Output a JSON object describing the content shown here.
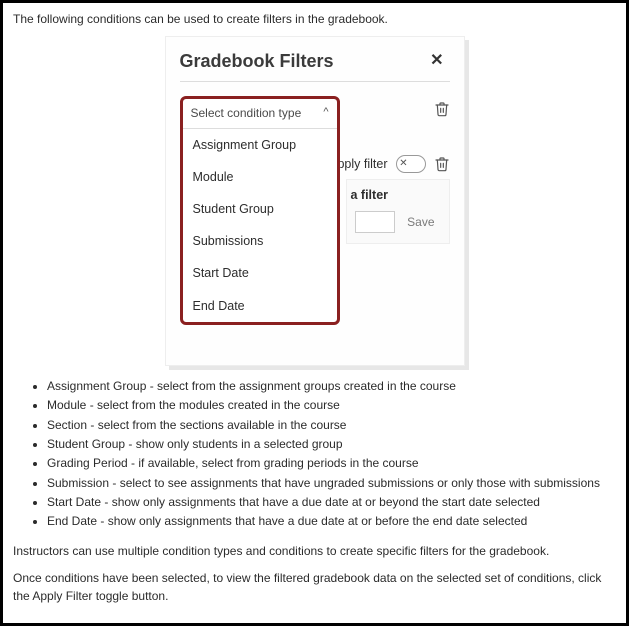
{
  "intro": "The following conditions can be used to create filters in the gradebook.",
  "panel": {
    "title": "Gradebook Filters",
    "dropdown": {
      "placeholder": "Select condition type",
      "options": {
        "o0": "Assignment Group",
        "o1": "Module",
        "o2": "Student Group",
        "o3": "Submissions",
        "o4": "Start Date",
        "o5": "End Date"
      }
    },
    "apply_label": "Apply filter",
    "filter_section_label": "a filter",
    "save_label": "Save"
  },
  "bullets": {
    "b0": "Assignment Group - select from the assignment groups created in the course",
    "b1": "Module - select from the modules created in the course",
    "b2": "Section - select from the sections available in the course",
    "b3": "Student Group - show only students in a selected group",
    "b4": "Grading Period - if available, select from grading periods in the course",
    "b5": "Submission - select to see assignments that have ungraded submissions or only those with submissions",
    "b6": "Start Date - show only assignments that have a due date at or beyond the start date selected",
    "b7": "End Date - show only assignments that have a due date at or before the end date selected"
  },
  "para1": "Instructors can use multiple condition types and conditions to create specific filters for the gradebook.",
  "para2": "Once conditions have been selected, to view the filtered gradebook data on the selected set of conditions, click the Apply Filter toggle button."
}
